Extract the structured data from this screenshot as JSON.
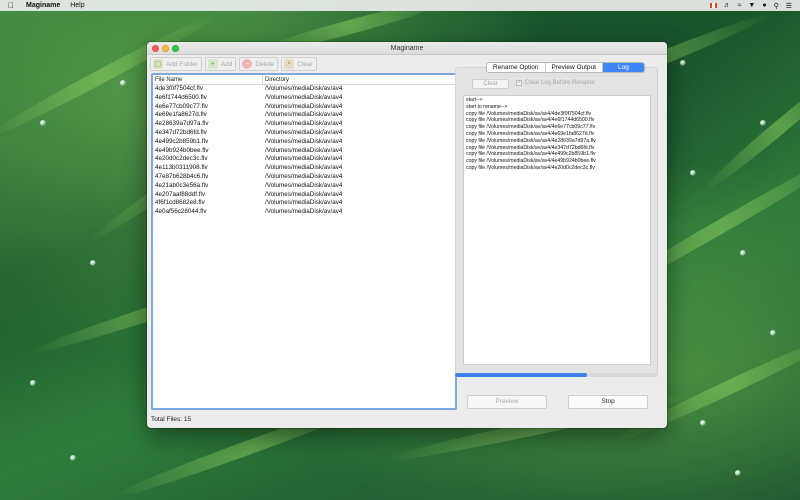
{
  "menubar": {
    "apple_icon": "apple-icon",
    "app_name": "Maginame",
    "items": [
      "Help"
    ],
    "status_icons": [
      "flag-ca-icon",
      "volume-icon",
      "wifi-icon",
      "vpn-icon",
      "user-icon",
      "search-icon",
      "menu-icon"
    ]
  },
  "window": {
    "title": "Maginame"
  },
  "toolbar": {
    "add_folder": "Add Folder",
    "add": "Add",
    "delete": "Delete",
    "clear": "Clear"
  },
  "table": {
    "headers": {
      "name": "File Name",
      "directory": "Directory"
    },
    "rows": [
      {
        "name": "4de3f0f7504cf.flv",
        "dir": "/Volumes/mediaDisk/av/av4"
      },
      {
        "name": "4e6f1744d6500.flv",
        "dir": "/Volumes/mediaDisk/av/av4"
      },
      {
        "name": "4e6e77cb09c77.flv",
        "dir": "/Volumes/mediaDisk/av/av4"
      },
      {
        "name": "4e69e1fa8627d.flv",
        "dir": "/Volumes/mediaDisk/av/av4"
      },
      {
        "name": "4e28639a7d97a.flv",
        "dir": "/Volumes/mediaDisk/av/av4"
      },
      {
        "name": "4e347d72bd6fd.flv",
        "dir": "/Volumes/mediaDisk/av/av4"
      },
      {
        "name": "4e499c2b859b1.flv",
        "dir": "/Volumes/mediaDisk/av/av4"
      },
      {
        "name": "4e49b924b0bee.flv",
        "dir": "/Volumes/mediaDisk/av/av4"
      },
      {
        "name": "4e20d0c2dec3c.flv",
        "dir": "/Volumes/mediaDisk/av/av4"
      },
      {
        "name": "4e113b0311908.flv",
        "dir": "/Volumes/mediaDisk/av/av4"
      },
      {
        "name": "47e87b628b4c6.flv",
        "dir": "/Volumes/mediaDisk/av/av4"
      },
      {
        "name": "4e21ab0c3e56a.flv",
        "dir": "/Volumes/mediaDisk/av/av4"
      },
      {
        "name": "4e207aaf88ddf.flv",
        "dir": "/Volumes/mediaDisk/av/av4"
      },
      {
        "name": "4f6f1cd8682e8.flv",
        "dir": "/Volumes/mediaDisk/av/av4"
      },
      {
        "name": "4e0af56c28044.flv",
        "dir": "/Volumes/mediaDisk/av/av4"
      }
    ],
    "total_label": "Total Files:  15"
  },
  "tabs": {
    "rename_option": "Rename Option",
    "preview_output": "Preview Output",
    "log": "Log"
  },
  "log_panel": {
    "clear_button": "Clear",
    "checkbox_label": "Clear Log Before Rename",
    "checkbox_checked": true,
    "lines": [
      "start-->",
      "start to rename-->",
      "copy file /Volumes/mediaDisk/av/av4/4de3f0f7504cf.flv",
      "copy file /Volumes/mediaDisk/av/av4/4e6f1744d6500.flv",
      "copy file /Volumes/mediaDisk/av/av4/4e6e77cb09c77.flv",
      "copy file /Volumes/mediaDisk/av/av4/4e69e1fa8627d.flv",
      "copy file /Volumes/mediaDisk/av/av4/4e28639a7d97a.flv",
      "copy file /Volumes/mediaDisk/av/av4/4e347d72bd6fd.flv",
      "copy file /Volumes/mediaDisk/av/av4/4e499c2b859b1.flv",
      "copy file /Volumes/mediaDisk/av/av4/4e49b924b0bee.flv",
      "copy file /Volumes/mediaDisk/av/av4/4e20d0c2dec3c.flv"
    ],
    "progress_fraction": 0.65
  },
  "buttons": {
    "preview": "Preview",
    "stop": "Stop"
  },
  "colors": {
    "accent": "#3f86f4",
    "selection_border": "#7fa7e0",
    "close": "#fc605c",
    "minimize": "#fdbc40",
    "maximize": "#34c84a"
  }
}
